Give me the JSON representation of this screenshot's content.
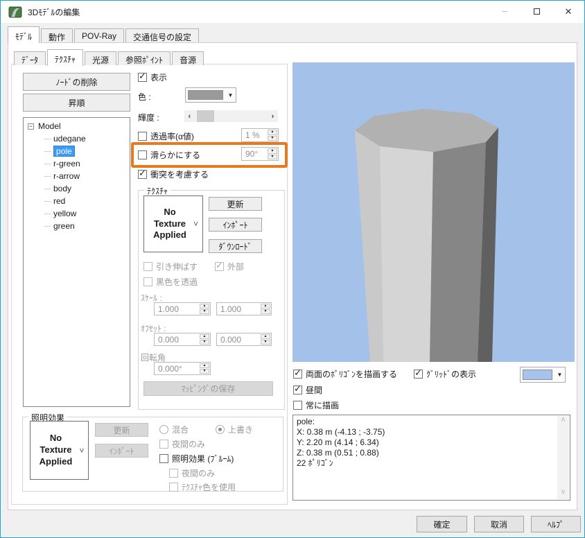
{
  "window": {
    "title": "3Dﾓﾃﾞﾙの編集"
  },
  "main_tabs": {
    "model": "ﾓﾃﾞﾙ",
    "motion": "動作",
    "povray": "POV-Ray",
    "traffic_signal": "交通信号の設定"
  },
  "sub_tabs": {
    "data": "ﾃﾞｰﾀ",
    "texture": "ﾃｸｽﾁｬ",
    "light": "光源",
    "ref_point": "参照ﾎﾟｲﾝﾄ",
    "sound": "音源"
  },
  "left": {
    "delete_node": "ﾉｰﾄﾞの削除",
    "ascending": "昇順",
    "tree": {
      "root": "Model",
      "children": [
        "udegane",
        "pole",
        "r-green",
        "r-arrow",
        "body",
        "red",
        "yellow",
        "green"
      ],
      "selected": "pole"
    }
  },
  "props": {
    "show": "表示",
    "color_label": "色 :",
    "brightness_label": "輝度 :",
    "alpha_label": "透過率(α値)",
    "alpha_value": "1 %",
    "smooth_label": "滑らかにする",
    "smooth_value": "90°",
    "collision": "衝突を考慮する"
  },
  "texture": {
    "group": "ﾃｸｽﾁｬ",
    "no_texture": "No Texture Applied",
    "update": "更新",
    "import": "ｲﾝﾎﾟｰﾄ",
    "download": "ﾀﾞｳﾝﾛｰﾄﾞ",
    "stretch": "引き伸ばす",
    "external": "外部",
    "black_transparent": "黒色を透過",
    "scale_label": "ｽｹｰﾙ :",
    "scale_x": "1.000",
    "scale_y": "1.000",
    "offset_label": "ｵﾌｾｯﾄ :",
    "offset_x": "0.000",
    "offset_y": "0.000",
    "rotation_label": "回転角",
    "rotation_value": "0.000°",
    "save_mapping": "ﾏｯﾋﾟﾝｸﾞの保存"
  },
  "lighting": {
    "group": "照明効果",
    "no_texture": "No Texture Applied",
    "update": "更新",
    "import": "ｲﾝﾎﾟｰﾄ",
    "blend": "混合",
    "overwrite": "上書き",
    "night_only": "夜間のみ",
    "bloom": "照明効果 (ﾌﾞﾙｰﾑ)",
    "night_only2": "夜間のみ",
    "use_texture_color": "ﾃｸｽﾁｬ色を使用"
  },
  "viewport": {
    "background_color": "#a4c1ea",
    "pole": {
      "top": "#b1b1b1",
      "facet1": "#c9c9c9",
      "facet2": "#d5d5d5",
      "facet3": "#868686",
      "facet4": "#606060"
    },
    "both_faces": "両面のﾎﾟﾘｺﾞﾝを描画する",
    "grid": "ｸﾞﾘｯﾄﾞの表示",
    "daytime": "昼間",
    "always_draw": "常に描画",
    "bg_swatch_color": "#a6c3ec"
  },
  "info": {
    "text": "pole:\nX: 0.38 m (-4.13 ; -3.75)\nY: 2.20 m (4.14 ; 6.34)\nZ: 0.38 m (0.51 ; 0.88)\n22 ﾎﾟﾘｺﾞﾝ"
  },
  "footer": {
    "confirm": "確定",
    "cancel": "取消",
    "help": "ﾍﾙﾌﾟ"
  },
  "colors": {
    "accent_border": "#26a0da",
    "highlight_box": "#e8791d",
    "tree_selection": "#3d9bf5",
    "model_color_swatch": "#9a9a9a"
  },
  "icons": {
    "minimize": "─",
    "close": "✕",
    "check": "✓",
    "dropdown_arrow": "▼",
    "chevron_down": "˅",
    "spin_up": "▲",
    "spin_down": "▼",
    "scroll_left": "‹",
    "scroll_right": "›",
    "scroll_up": "∧",
    "scroll_down": "∨",
    "tree_collapse": "−"
  }
}
